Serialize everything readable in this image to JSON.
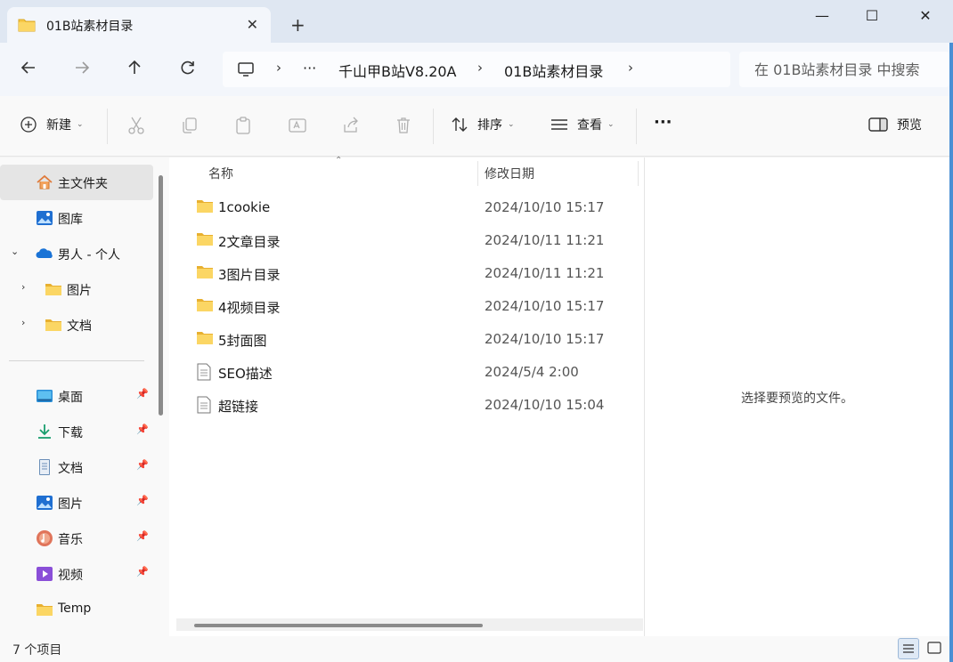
{
  "window": {
    "tab_title": "01B站素材目录",
    "tab_close": "✕",
    "new_tab": "+",
    "minimize": "—",
    "maximize": "☐",
    "close": "✕"
  },
  "address": {
    "more": "···",
    "crumbs": [
      "千山甲B站V8.20A",
      "01B站素材目录"
    ],
    "search_placeholder": "在 01B站素材目录 中搜索"
  },
  "toolbar": {
    "new_label": "新建",
    "sort_label": "排序",
    "view_label": "查看",
    "more": "···",
    "preview_label": "预览"
  },
  "sidebar": {
    "items": [
      {
        "label": "主文件夹",
        "icon": "home-icon"
      },
      {
        "label": "图库",
        "icon": "gallery-icon"
      },
      {
        "label": "男人 - 个人",
        "icon": "onedrive-icon"
      },
      {
        "label": "图片",
        "icon": "folder-icon"
      },
      {
        "label": "文档",
        "icon": "folder-icon"
      },
      {
        "label": "桌面",
        "icon": "desktop-icon"
      },
      {
        "label": "下载",
        "icon": "download-icon"
      },
      {
        "label": "文档",
        "icon": "documents-icon"
      },
      {
        "label": "图片",
        "icon": "pictures-icon"
      },
      {
        "label": "音乐",
        "icon": "music-icon"
      },
      {
        "label": "视频",
        "icon": "videos-icon"
      },
      {
        "label": "Temp",
        "icon": "folder-icon"
      }
    ]
  },
  "filelist": {
    "columns": [
      "名称",
      "修改日期"
    ],
    "rows": [
      {
        "name": "1cookie",
        "date": "2024/10/10 15:17",
        "type": "folder"
      },
      {
        "name": "2文章目录",
        "date": "2024/10/11 11:21",
        "type": "folder"
      },
      {
        "name": "3图片目录",
        "date": "2024/10/11 11:21",
        "type": "folder"
      },
      {
        "name": "4视频目录",
        "date": "2024/10/10 15:17",
        "type": "folder"
      },
      {
        "name": "5封面图",
        "date": "2024/10/10 15:17",
        "type": "folder"
      },
      {
        "name": "SEO描述",
        "date": "2024/5/4 2:00",
        "type": "file"
      },
      {
        "name": "超链接",
        "date": "2024/10/10 15:04",
        "type": "file"
      }
    ]
  },
  "preview": {
    "message": "选择要预览的文件。"
  },
  "status": {
    "item_count": "7 个项目"
  },
  "colors": {
    "accent": "#0067c0",
    "folder": "#f7c948"
  }
}
